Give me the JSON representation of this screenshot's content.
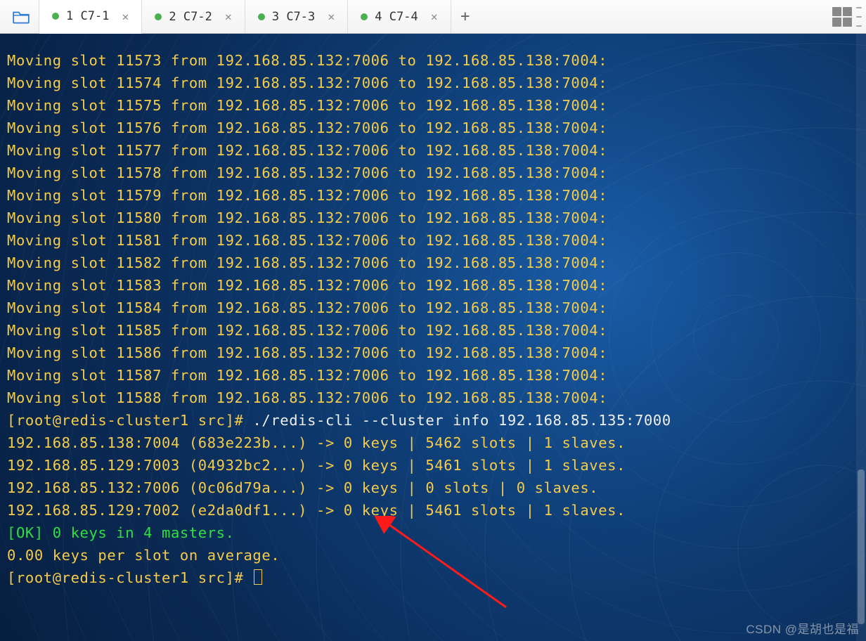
{
  "tabs": [
    {
      "label": "1 C7-1",
      "active": true
    },
    {
      "label": "2 C7-2",
      "active": false
    },
    {
      "label": "3 C7-3",
      "active": false
    },
    {
      "label": "4 C7-4",
      "active": false
    }
  ],
  "add_tab_glyph": "+",
  "close_glyph": "✕",
  "terminal": {
    "moving_lines": [
      "Moving slot 11573 from 192.168.85.132:7006 to 192.168.85.138:7004:",
      "Moving slot 11574 from 192.168.85.132:7006 to 192.168.85.138:7004:",
      "Moving slot 11575 from 192.168.85.132:7006 to 192.168.85.138:7004:",
      "Moving slot 11576 from 192.168.85.132:7006 to 192.168.85.138:7004:",
      "Moving slot 11577 from 192.168.85.132:7006 to 192.168.85.138:7004:",
      "Moving slot 11578 from 192.168.85.132:7006 to 192.168.85.138:7004:",
      "Moving slot 11579 from 192.168.85.132:7006 to 192.168.85.138:7004:",
      "Moving slot 11580 from 192.168.85.132:7006 to 192.168.85.138:7004:",
      "Moving slot 11581 from 192.168.85.132:7006 to 192.168.85.138:7004:",
      "Moving slot 11582 from 192.168.85.132:7006 to 192.168.85.138:7004:",
      "Moving slot 11583 from 192.168.85.132:7006 to 192.168.85.138:7004:",
      "Moving slot 11584 from 192.168.85.132:7006 to 192.168.85.138:7004:",
      "Moving slot 11585 from 192.168.85.132:7006 to 192.168.85.138:7004:",
      "Moving slot 11586 from 192.168.85.132:7006 to 192.168.85.138:7004:",
      "Moving slot 11587 from 192.168.85.132:7006 to 192.168.85.138:7004:",
      "Moving slot 11588 from 192.168.85.132:7006 to 192.168.85.138:7004:"
    ],
    "prompt_cmd": {
      "prompt": "[root@redis-cluster1 src]# ",
      "cmd": "./redis-cli --cluster info 192.168.85.135:7000"
    },
    "cluster_info": [
      "192.168.85.138:7004 (683e223b...) -> 0 keys | 5462 slots | 1 slaves.",
      "192.168.85.129:7003 (04932bc2...) -> 0 keys | 5461 slots | 1 slaves.",
      "192.168.85.132:7006 (0c06d79a...) -> 0 keys | 0 slots | 0 slaves.",
      "192.168.85.129:7002 (e2da0df1...) -> 0 keys | 5461 slots | 1 slaves."
    ],
    "ok_line": "[OK] 0 keys in 4 masters.",
    "avg_line": "0.00 keys per slot on average.",
    "final_prompt": "[root@redis-cluster1 src]# "
  },
  "watermark": "CSDN @是胡也是福"
}
